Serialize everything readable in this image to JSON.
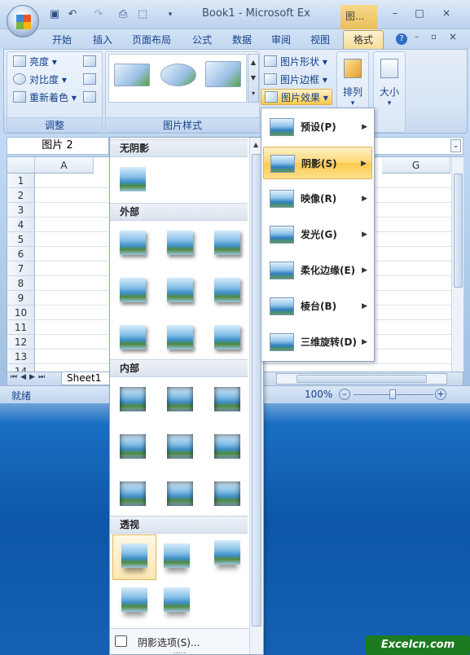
{
  "window": {
    "title": "Book1 - Microsoft Ex",
    "context_tab": "图...",
    "min": "–",
    "max": "□",
    "close": "×"
  },
  "qat": {
    "save_icon": "save-icon",
    "undo_icon": "undo-icon",
    "redo_icon": "redo-icon"
  },
  "tabs": [
    "开始",
    "插入",
    "页面布局",
    "公式",
    "数据",
    "审阅",
    "视图",
    "格式"
  ],
  "ribbon": {
    "adjust": {
      "brightness": "亮度",
      "contrast": "对比度",
      "recolor": "重新着色",
      "label": "调整"
    },
    "styles": {
      "label": "图片样式",
      "shape": "图片形状",
      "border": "图片边框",
      "effects": "图片效果"
    },
    "arrange": {
      "label": "排列"
    },
    "size": {
      "label": "大小"
    }
  },
  "formula": {
    "namebox": "图片 2"
  },
  "sheet": {
    "columns": [
      "A",
      "G"
    ],
    "rows": [
      "1",
      "2",
      "3",
      "4",
      "5",
      "6",
      "7",
      "8",
      "9",
      "10",
      "11",
      "12",
      "13",
      "14"
    ],
    "tab": "Sheet1"
  },
  "status": {
    "ready": "就绪",
    "zoom": "100%"
  },
  "gallery": {
    "sections": [
      "无阴影",
      "外部",
      "内部",
      "透视"
    ],
    "options": "阴影选项(S)...",
    "grip": "....."
  },
  "effects_menu": [
    "预设(P)",
    "阴影(S)",
    "映像(R)",
    "发光(G)",
    "柔化边缘(E)",
    "棱台(B)",
    "三维旋转(D)"
  ],
  "watermark": "Excelcn.com"
}
